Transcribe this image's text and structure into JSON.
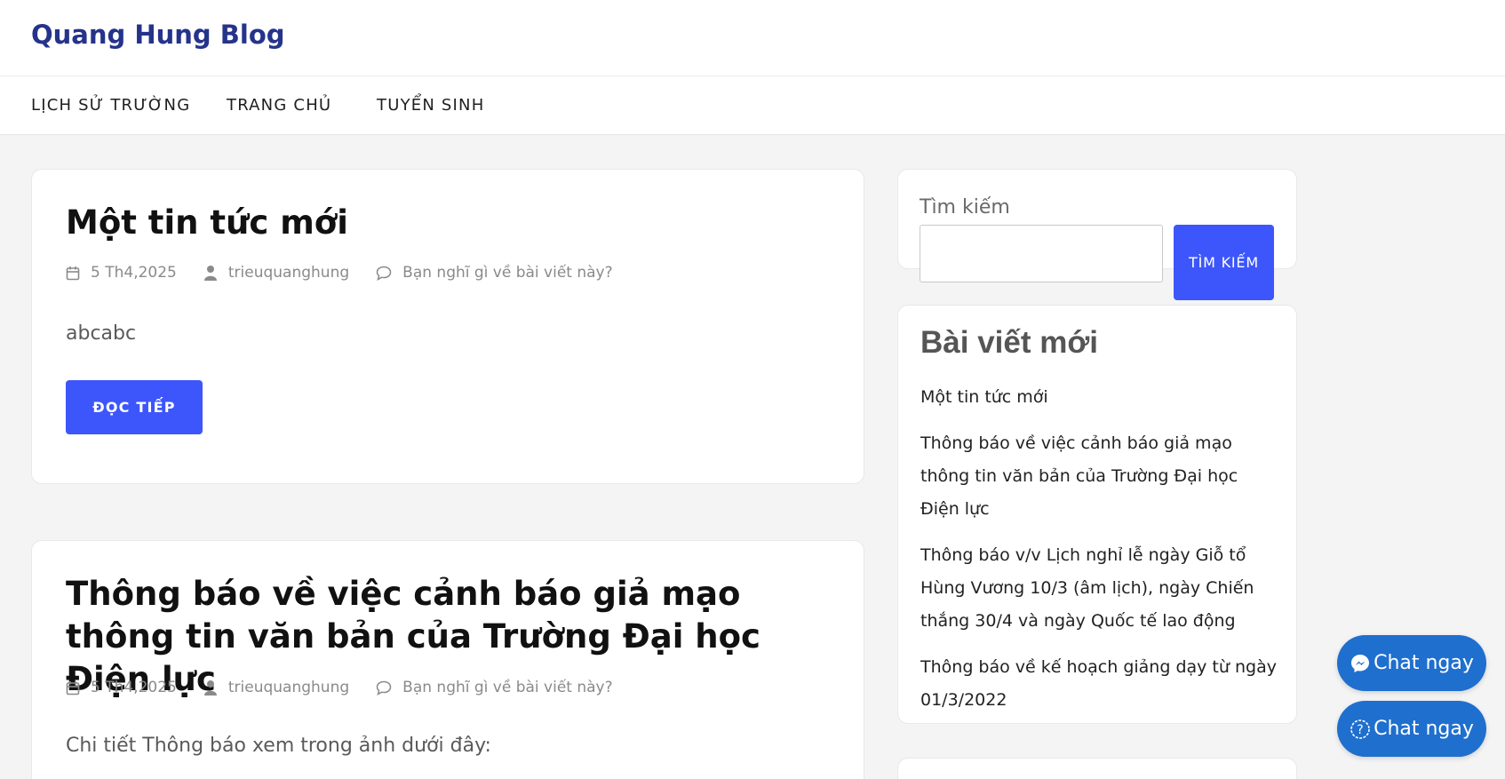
{
  "site": {
    "title": "Quang Hung Blog"
  },
  "nav": {
    "items": [
      "LỊCH SỬ TRƯỜNG",
      "TRANG CHỦ",
      "TUYỂN SINH"
    ]
  },
  "posts": [
    {
      "title": "Một tin tức mới",
      "date": "5 Th4,2025",
      "author": "trieuquanghung",
      "comments": "Bạn nghĩ gì về bài viết này?",
      "excerpt": "abcabc",
      "read_more": "ĐỌC TIẾP"
    },
    {
      "title": "Thông báo về việc cảnh báo giả mạo thông tin văn bản của Trường Đại học Điện lực",
      "date": "5 Th4,2025",
      "author": "trieuquanghung",
      "comments": "Bạn nghĩ gì về bài viết này?",
      "excerpt": "Chi tiết Thông báo xem trong ảnh dưới đây:"
    }
  ],
  "search": {
    "label": "Tìm kiếm",
    "value": "",
    "button": "TÌM KIẾM"
  },
  "recent": {
    "title": "Bài viết mới",
    "items": [
      "Một tin tức mới",
      "Thông báo về việc cảnh báo giả mạo thông tin văn bản của Trường Đại học Điện lực",
      "Thông báo v/v Lịch nghỉ lễ ngày Giỗ tổ Hùng Vương 10/3 (âm lịch), ngày Chiến thắng 30/4 và ngày Quốc tế lao động",
      "Thông báo về kế hoạch giảng dạy từ ngày 01/3/2022"
    ]
  },
  "chat": {
    "messenger_label": "Chat ngay",
    "help_label": "Chat ngay"
  },
  "colors": {
    "accent": "#3d56fb",
    "brand": "#25338b",
    "chat": "#1f6fce"
  }
}
